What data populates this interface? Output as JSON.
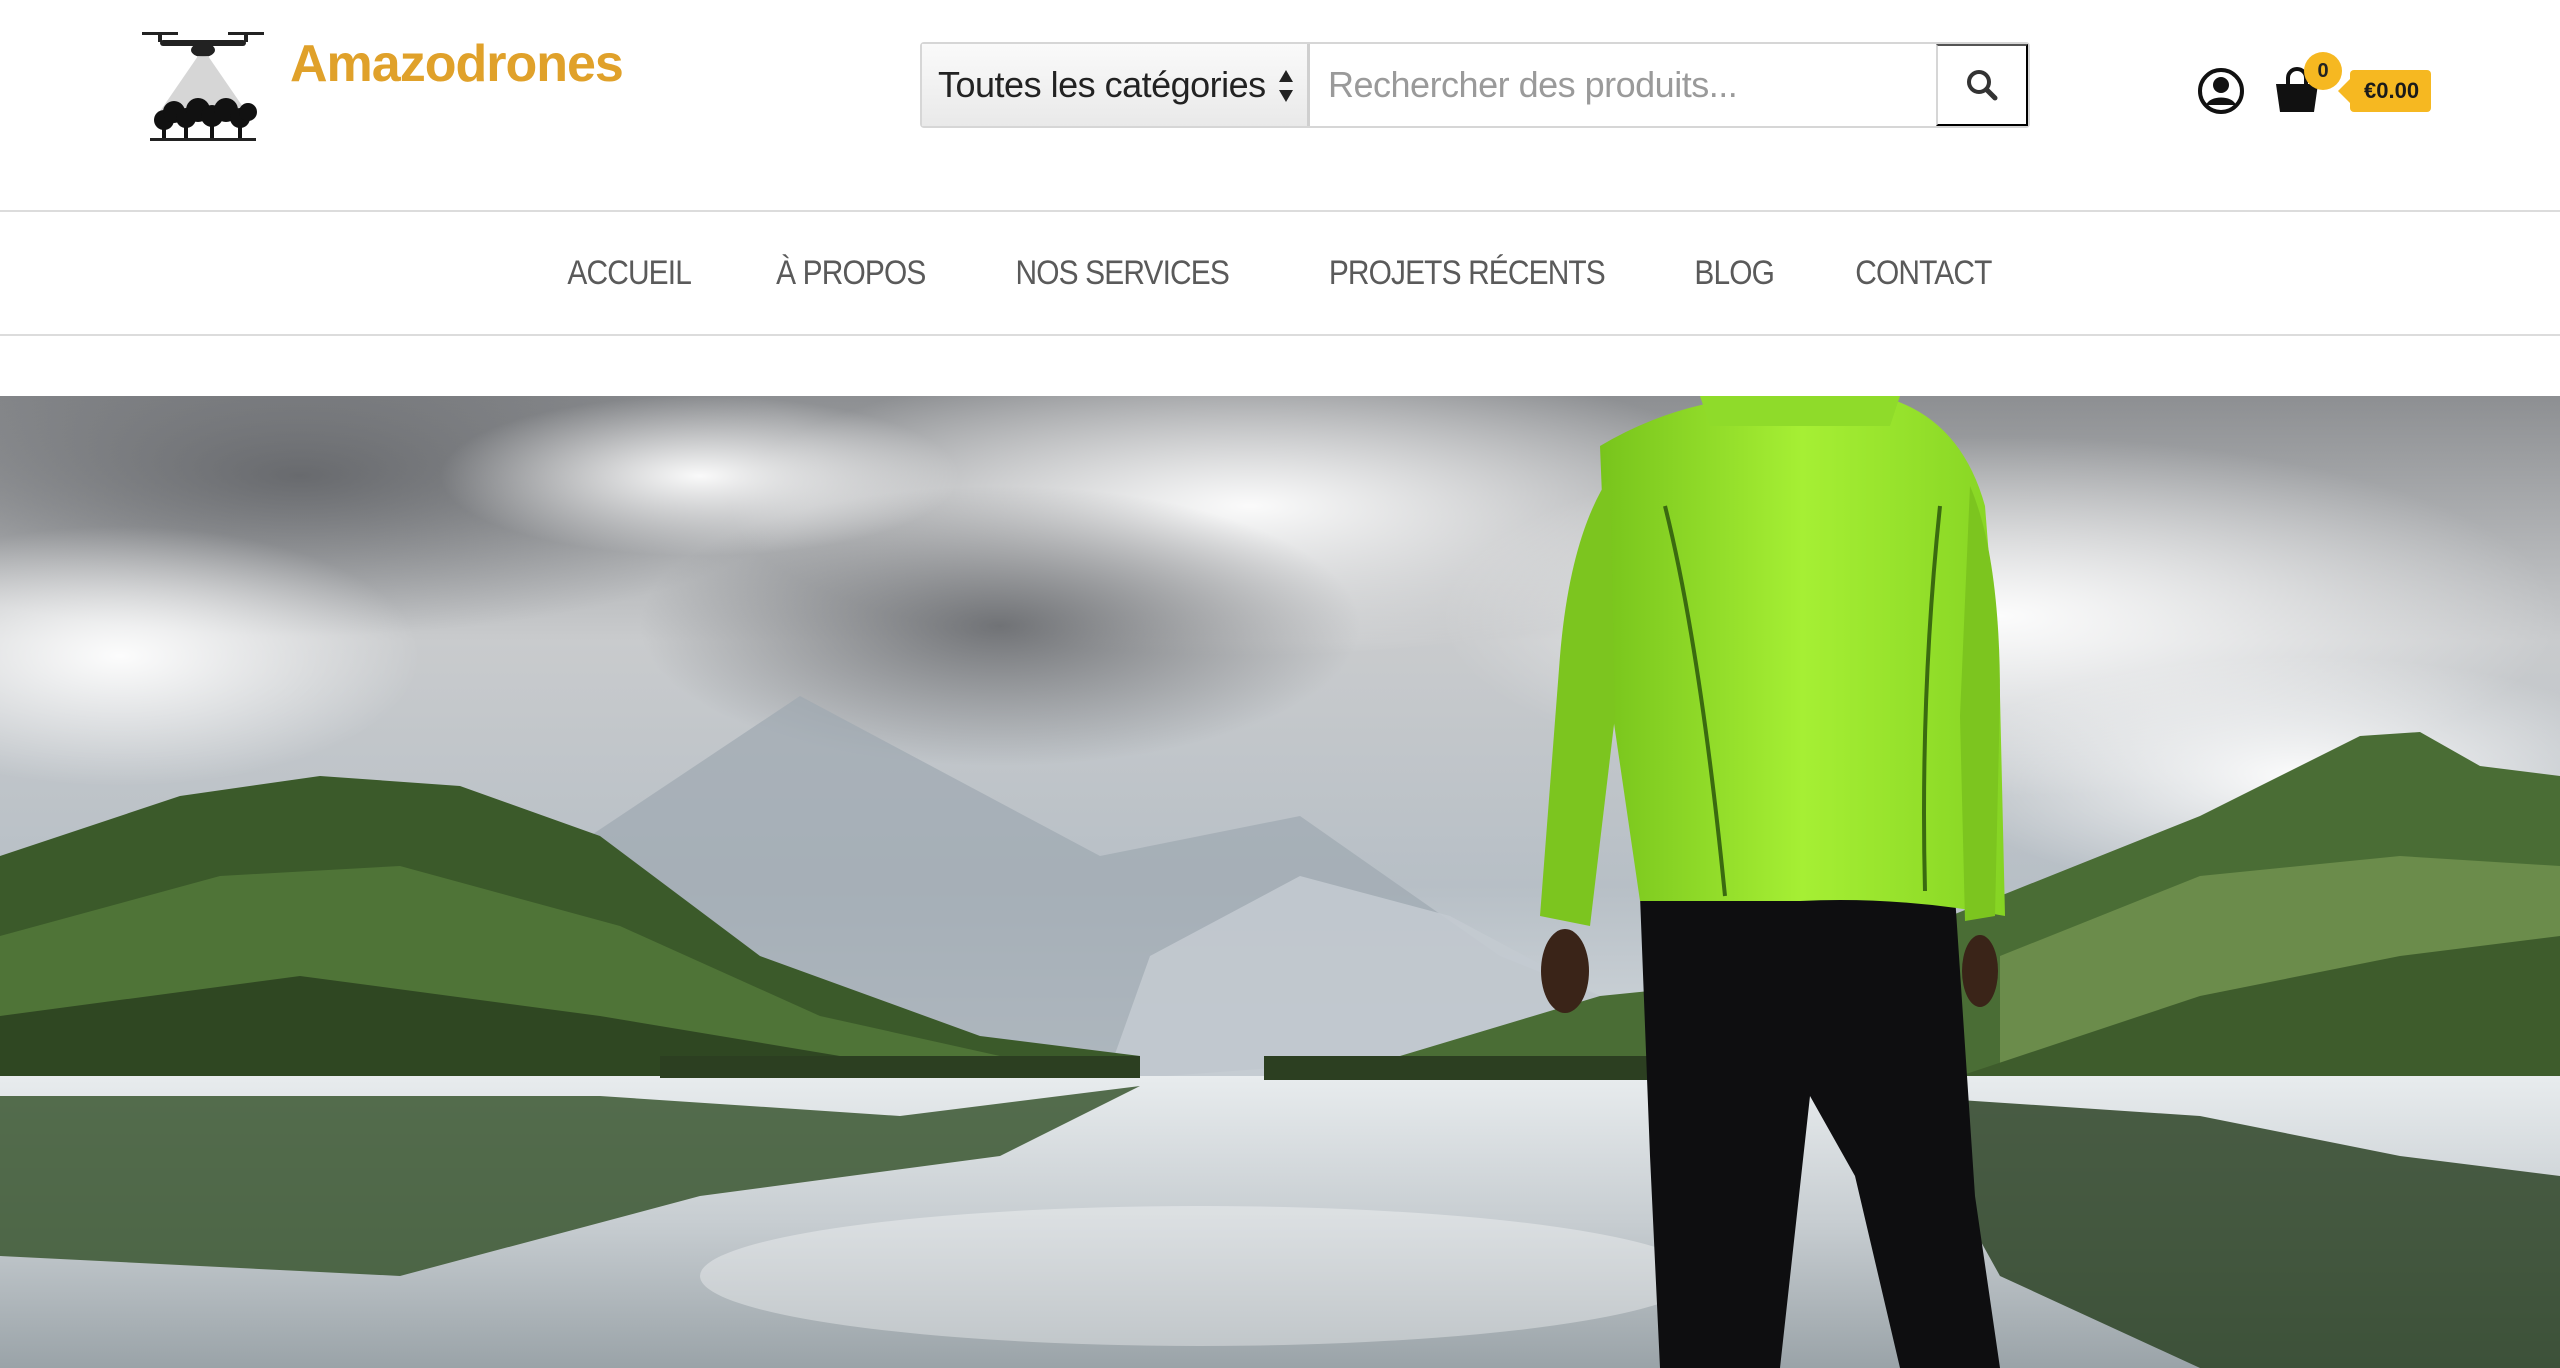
{
  "site": {
    "title": "Amazodrones",
    "brand_color": "#e0a12a",
    "logo_icon": "drone-trees-logo"
  },
  "search": {
    "category_selected": "Toutes les catégories",
    "placeholder": "Rechercher des produits...",
    "button_icon": "search-icon"
  },
  "header_actions": {
    "account_icon": "user-circle-icon",
    "cart_icon": "shopping-bag-icon",
    "cart_count": "0",
    "cart_total": "€0.00",
    "accent": "#f6b821"
  },
  "nav": {
    "items": [
      {
        "label": "ACCUEIL"
      },
      {
        "label": "À PROPOS"
      },
      {
        "label": "NOS SERVICES"
      },
      {
        "label": "PROJETS RÉCENTS"
      },
      {
        "label": "BLOG"
      },
      {
        "label": "CONTACT"
      }
    ]
  },
  "hero": {
    "image": "mountain-lake-hiker-photo"
  }
}
